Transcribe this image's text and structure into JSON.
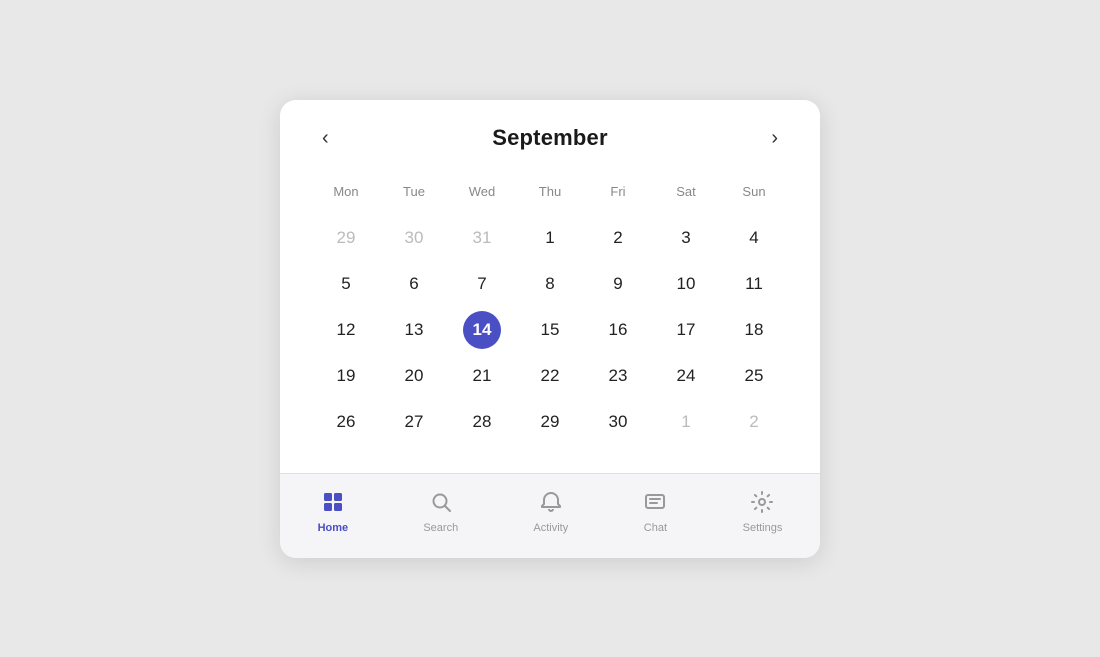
{
  "calendar": {
    "month": "September",
    "days_of_week": [
      "Mon",
      "Tue",
      "Wed",
      "Thu",
      "Fri",
      "Sat",
      "Sun"
    ],
    "weeks": [
      [
        {
          "day": "29",
          "muted": true
        },
        {
          "day": "30",
          "muted": true
        },
        {
          "day": "31",
          "muted": true
        },
        {
          "day": "1",
          "muted": false
        },
        {
          "day": "2",
          "muted": false
        },
        {
          "day": "3",
          "muted": false
        },
        {
          "day": "4",
          "muted": false
        }
      ],
      [
        {
          "day": "5",
          "muted": false
        },
        {
          "day": "6",
          "muted": false
        },
        {
          "day": "7",
          "muted": false
        },
        {
          "day": "8",
          "muted": false
        },
        {
          "day": "9",
          "muted": false
        },
        {
          "day": "10",
          "muted": false
        },
        {
          "day": "11",
          "muted": false
        }
      ],
      [
        {
          "day": "12",
          "muted": false
        },
        {
          "day": "13",
          "muted": false
        },
        {
          "day": "14",
          "muted": false,
          "selected": true
        },
        {
          "day": "15",
          "muted": false
        },
        {
          "day": "16",
          "muted": false
        },
        {
          "day": "17",
          "muted": false
        },
        {
          "day": "18",
          "muted": false
        }
      ],
      [
        {
          "day": "19",
          "muted": false
        },
        {
          "day": "20",
          "muted": false
        },
        {
          "day": "21",
          "muted": false
        },
        {
          "day": "22",
          "muted": false
        },
        {
          "day": "23",
          "muted": false
        },
        {
          "day": "24",
          "muted": false
        },
        {
          "day": "25",
          "muted": false
        }
      ],
      [
        {
          "day": "26",
          "muted": false
        },
        {
          "day": "27",
          "muted": false
        },
        {
          "day": "28",
          "muted": false
        },
        {
          "day": "29",
          "muted": false
        },
        {
          "day": "30",
          "muted": false
        },
        {
          "day": "1",
          "muted": true
        },
        {
          "day": "2",
          "muted": true
        }
      ]
    ],
    "prev_btn": "‹",
    "next_btn": "›"
  },
  "nav": {
    "items": [
      {
        "id": "home",
        "label": "Home",
        "active": true
      },
      {
        "id": "search",
        "label": "Search",
        "active": false
      },
      {
        "id": "activity",
        "label": "Activity",
        "active": false
      },
      {
        "id": "chat",
        "label": "Chat",
        "active": false
      },
      {
        "id": "settings",
        "label": "Settings",
        "active": false
      }
    ]
  }
}
